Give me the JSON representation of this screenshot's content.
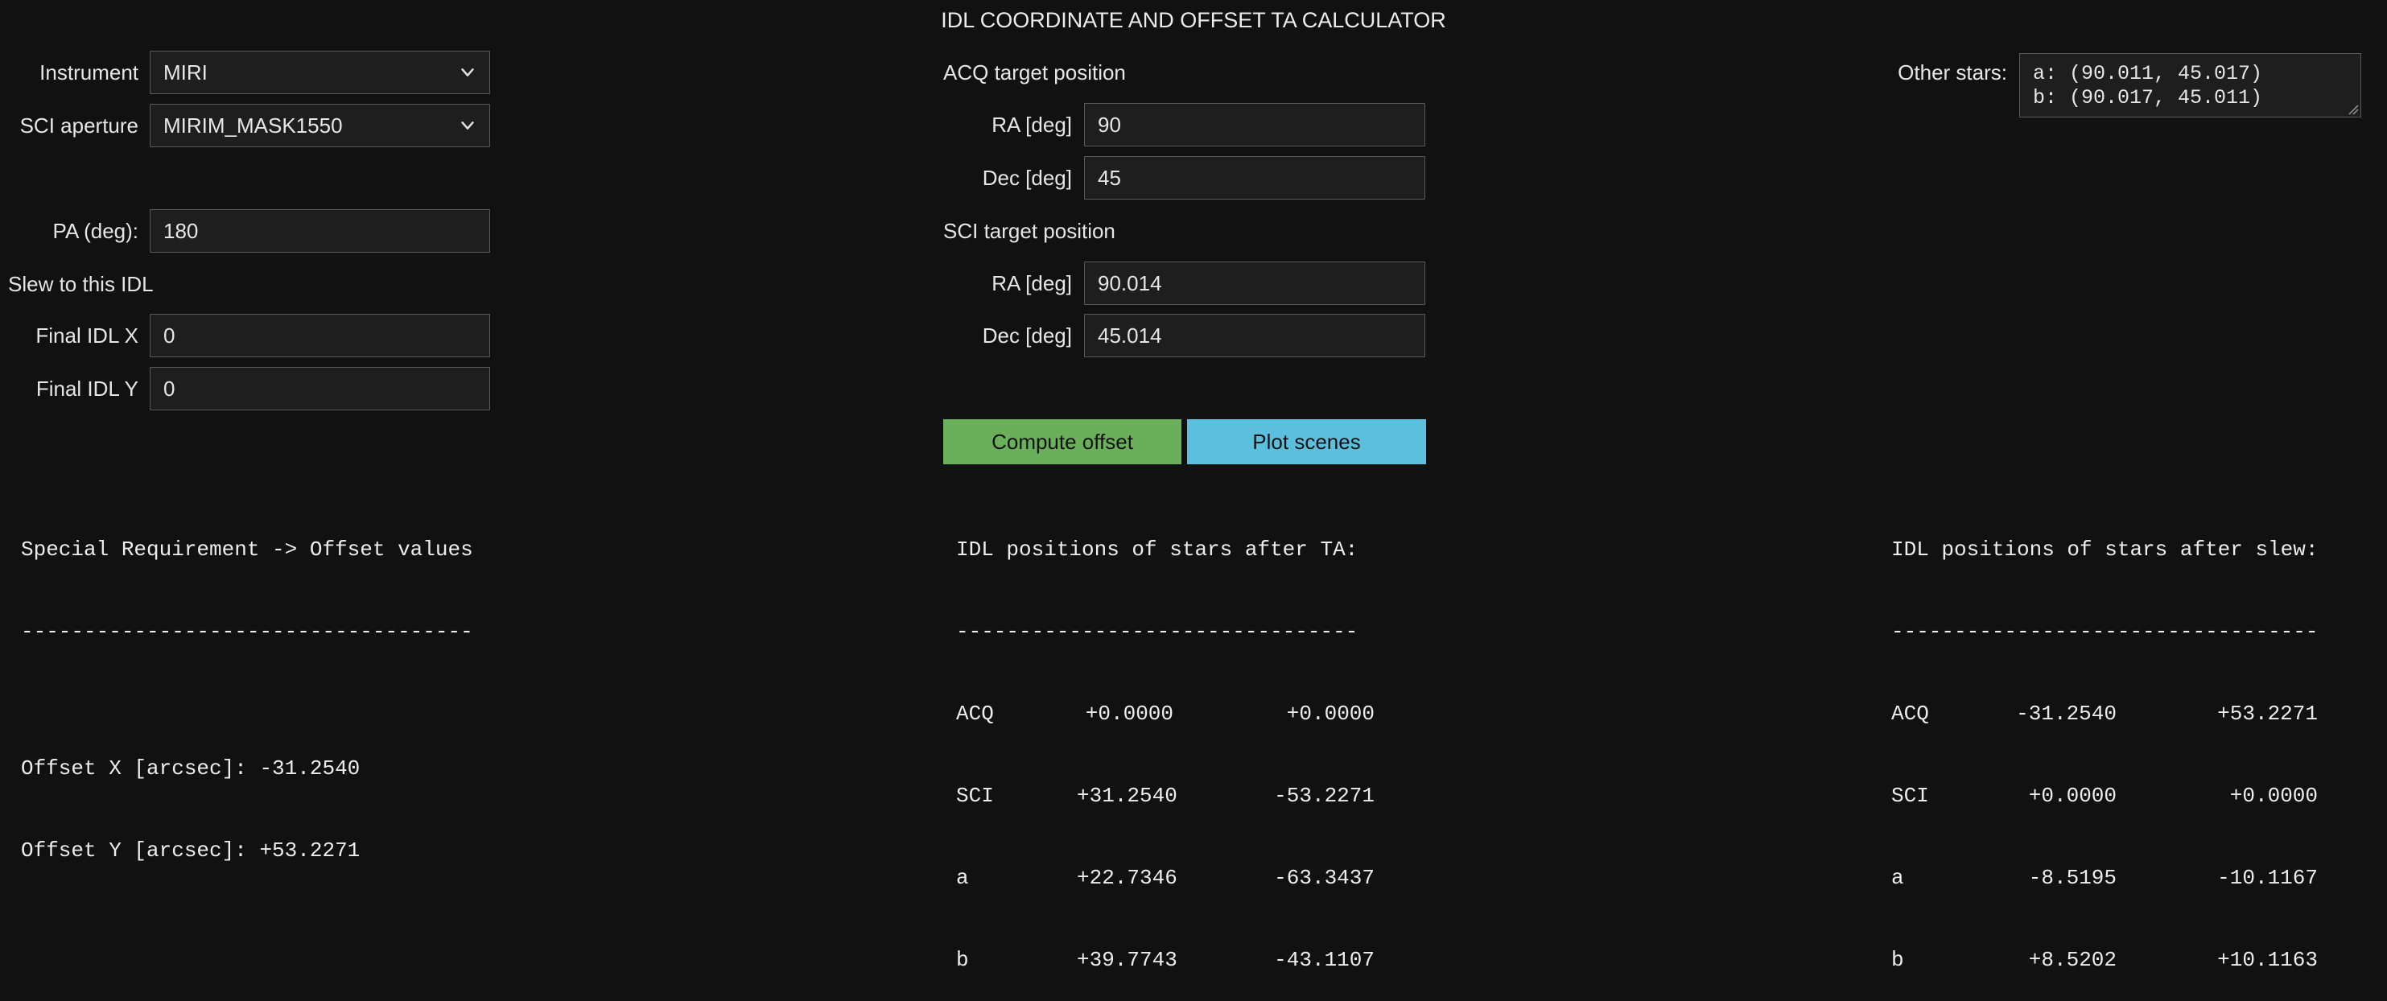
{
  "title": "IDL COORDINATE AND OFFSET TA CALCULATOR",
  "left": {
    "instrument_label": "Instrument",
    "instrument_value": "MIRI",
    "aperture_label": "SCI aperture",
    "aperture_value": "MIRIM_MASK1550",
    "pa_label": "PA (deg):",
    "pa_value": "180",
    "slew_heading": "Slew to this IDL",
    "idl_x_label": "Final IDL X",
    "idl_x_value": "0",
    "idl_y_label": "Final IDL Y",
    "idl_y_value": "0"
  },
  "acq": {
    "heading": "ACQ target position",
    "ra_label": "RA [deg]",
    "ra_value": "90",
    "dec_label": "Dec [deg]",
    "dec_value": "45"
  },
  "sci": {
    "heading": "SCI target position",
    "ra_label": "RA [deg]",
    "ra_value": "90.014",
    "dec_label": "Dec [deg]",
    "dec_value": "45.014"
  },
  "other_stars": {
    "label": "Other stars:",
    "value": "a: (90.011, 45.017)\nb: (90.017, 45.011)"
  },
  "buttons": {
    "compute": "Compute offset",
    "plot": "Plot scenes"
  },
  "colors": {
    "compute_button": "#6ab05a",
    "plot_button": "#5bc0de",
    "background": "#111111"
  },
  "icons": [
    "chevron-down-icon",
    "resize-grip-icon"
  ],
  "offset_output": {
    "heading": "Special Requirement -> Offset values",
    "rule": "------------------------------------",
    "lines": [
      "Offset X [arcsec]: -31.2540",
      "Offset Y [arcsec]: +53.2271"
    ]
  },
  "after_ta": {
    "heading": "IDL positions of stars after TA:",
    "rule": "--------------------------------",
    "rows": [
      {
        "name": "ACQ",
        "x": "+0.0000",
        "y": "+0.0000"
      },
      {
        "name": "SCI",
        "x": "+31.2540",
        "y": "-53.2271"
      },
      {
        "name": "a",
        "x": "+22.7346",
        "y": "-63.3437"
      },
      {
        "name": "b",
        "x": "+39.7743",
        "y": "-43.1107"
      }
    ]
  },
  "after_slew": {
    "heading": "IDL positions of stars after slew:",
    "rule": "----------------------------------",
    "rows": [
      {
        "name": "ACQ",
        "x": "-31.2540",
        "y": "+53.2271"
      },
      {
        "name": "SCI",
        "x": "+0.0000",
        "y": "+0.0000"
      },
      {
        "name": "a",
        "x": "-8.5195",
        "y": "-10.1167"
      },
      {
        "name": "b",
        "x": "+8.5202",
        "y": "+10.1163"
      }
    ]
  }
}
